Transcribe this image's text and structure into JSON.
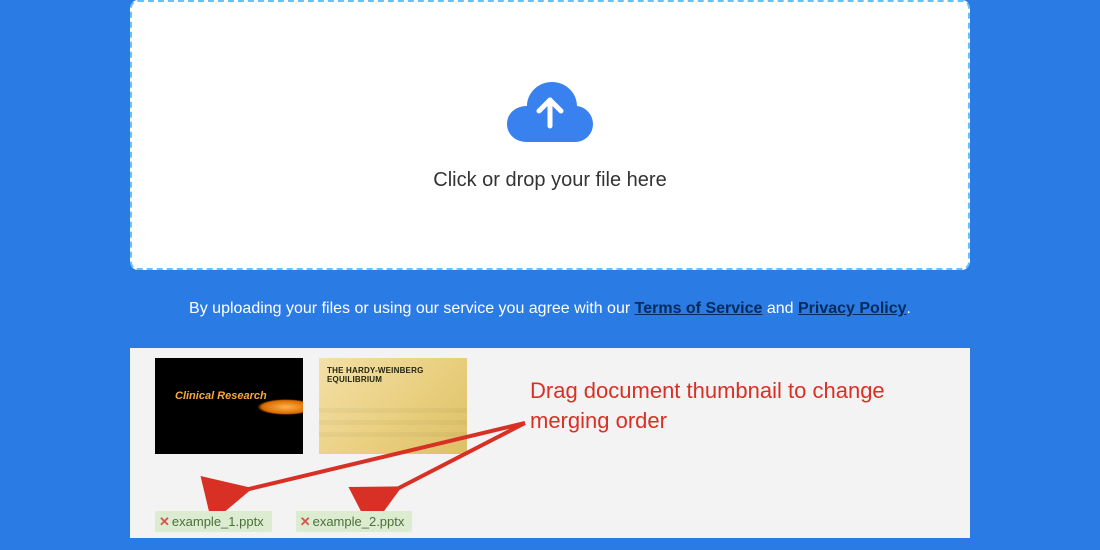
{
  "dropzone": {
    "prompt": "Click or drop your file here",
    "icon": "cloud-upload-icon"
  },
  "agreement": {
    "prefix": "By uploading your files or using our service you agree with our ",
    "tos_label": "Terms of Service",
    "connector": " and ",
    "privacy_label": "Privacy Policy",
    "suffix": "."
  },
  "thumbnails": [
    {
      "title": "Clinical Research",
      "chip_label": "example_1.pptx"
    },
    {
      "title_line1": "THE HARDY-WEINBERG",
      "title_line2": "EQUILIBRIUM",
      "chip_label": "example_2.pptx"
    }
  ],
  "annotation": {
    "line1": "Drag document thumbnail to change",
    "line2": "merging order"
  },
  "colors": {
    "page_bg": "#2a7be4",
    "accent_blue": "#3a81f0",
    "annotation_red": "#d93025",
    "chip_bg": "#dbecd1"
  }
}
